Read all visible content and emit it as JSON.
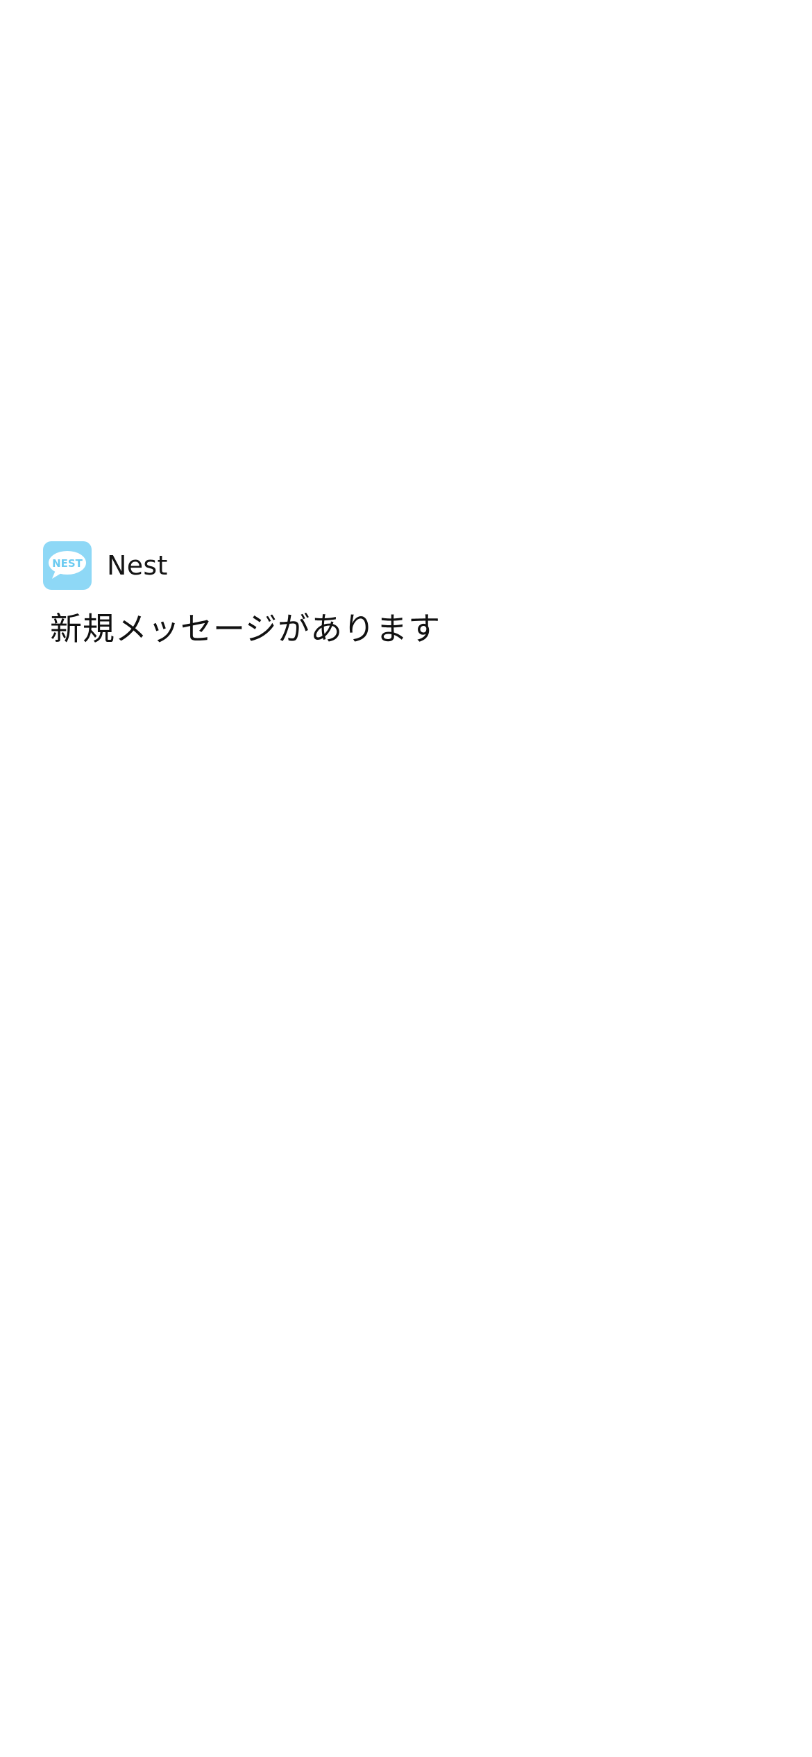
{
  "notification": {
    "app": {
      "name": "Nest",
      "icon": "nest-chat-bubble-icon",
      "icon_text": "NEST"
    },
    "message": "新規メッセージがあります"
  },
  "colors": {
    "background": "#ffffff",
    "app_icon_background": "#8ed8f6",
    "app_icon_bubble": "#ffffff",
    "app_icon_text": "#6ccbf1",
    "text": "#111111"
  }
}
